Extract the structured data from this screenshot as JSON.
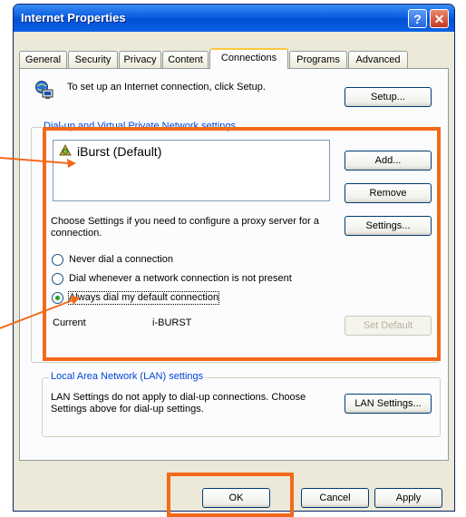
{
  "window": {
    "title": "Internet Properties",
    "help_glyph": "?",
    "close_glyph": "✕"
  },
  "tabs": [
    "General",
    "Security",
    "Privacy",
    "Content",
    "Connections",
    "Programs",
    "Advanced"
  ],
  "setup": {
    "text": "To set up an Internet connection, click Setup.",
    "button": "Setup..."
  },
  "dialup": {
    "group_title": "Dial-up and Virtual Private Network settings",
    "connections": [
      "iBurst (Default)"
    ],
    "add": "Add...",
    "remove": "Remove",
    "settings_text": "Choose Settings if you need to configure a proxy server for a connection.",
    "settings_button": "Settings...",
    "radios": [
      {
        "label": "Never dial a connection",
        "checked": false
      },
      {
        "label": "Dial whenever a network connection is not present",
        "checked": false
      },
      {
        "label": "Always dial my default connection",
        "checked": true
      }
    ],
    "current_label": "Current",
    "current_value": "i-BURST",
    "set_default": "Set Default"
  },
  "lan": {
    "group_title": "Local Area Network (LAN) settings",
    "text": "LAN Settings do not apply to dial-up connections. Choose Settings above for dial-up settings.",
    "button": "LAN Settings..."
  },
  "footer": {
    "ok": "OK",
    "cancel": "Cancel",
    "apply": "Apply"
  },
  "colors": {
    "highlight": "#f26a1b",
    "titlebar": "#0a5ee0",
    "radio_check": "#21a121"
  }
}
